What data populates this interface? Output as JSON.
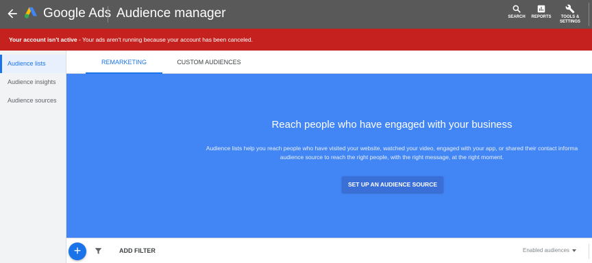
{
  "header": {
    "brand": "Google Ads",
    "title": "Audience manager",
    "tools": {
      "search": "SEARCH",
      "reports": "REPORTS",
      "settings_line1": "TOOLS &",
      "settings_line2": "SETTINGS"
    },
    "icons": {
      "back": "arrow-left-icon",
      "logo": "google-ads-logo",
      "search": "search-icon",
      "reports": "reports-icon",
      "settings": "wrench-icon"
    }
  },
  "alert": {
    "strong": "Your account isn't active",
    "text": " - Your ads aren't running because your account has been canceled."
  },
  "sidebar": {
    "items": [
      {
        "label": "Audience lists",
        "active": true
      },
      {
        "label": "Audience insights",
        "active": false
      },
      {
        "label": "Audience sources",
        "active": false
      }
    ]
  },
  "tabs": [
    {
      "label": "REMARKETING",
      "active": true
    },
    {
      "label": "CUSTOM AUDIENCES",
      "active": false
    }
  ],
  "hero": {
    "title": "Reach people who have engaged with your business",
    "desc_line1": "Audience lists help you reach people who have visited your website, watched your video, engaged with your app, or shared their contact informa",
    "desc_line2": "audience source to reach the right people, with the right message, at the right moment.",
    "cta": "SET UP AN AUDIENCE SOURCE"
  },
  "filterbar": {
    "add": "+",
    "add_filter": "ADD FILTER",
    "enabled": "Enabled audiences"
  },
  "colors": {
    "topbar": "#595959",
    "alert": "#c5221f",
    "hero": "#4285f4",
    "accent": "#1a73e8"
  }
}
